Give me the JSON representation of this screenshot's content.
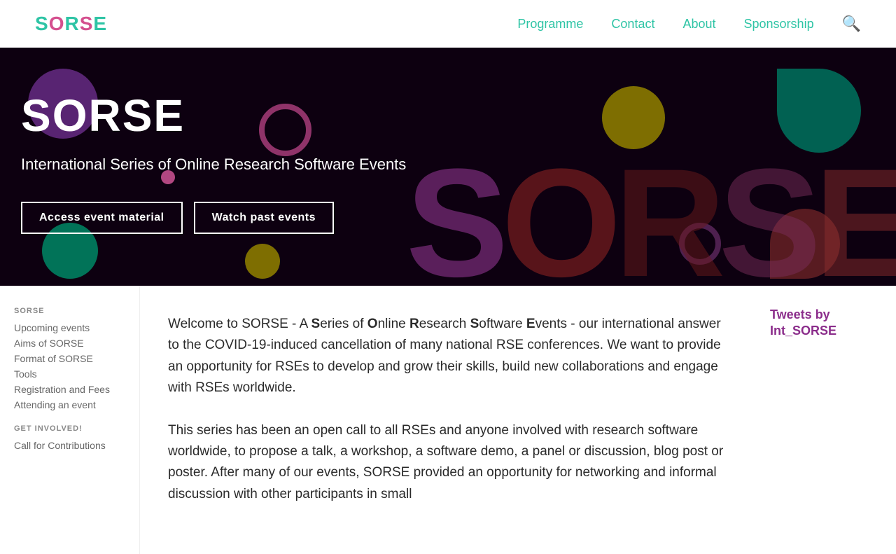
{
  "nav": {
    "logo": {
      "s1": "S",
      "o": "O",
      "r": "R",
      "s2": "S",
      "e": "E"
    },
    "links": [
      {
        "id": "programme",
        "label": "Programme"
      },
      {
        "id": "contact",
        "label": "Contact"
      },
      {
        "id": "about",
        "label": "About"
      },
      {
        "id": "sponsorship",
        "label": "Sponsorship"
      }
    ]
  },
  "hero": {
    "title": "SORSE",
    "subtitle": "International Series of Online Research Software Events",
    "button1": "Access event material",
    "button2": "Watch past events"
  },
  "sidebar": {
    "section1_title": "SORSE",
    "section1_links": [
      "Upcoming events",
      "Aims of SORSE",
      "Format of SORSE",
      "Tools",
      "Registration and Fees",
      "Attending an event"
    ],
    "section2_title": "GET INVOLVED!",
    "section2_links": [
      "Call for Contributions"
    ]
  },
  "content": {
    "para1_prefix": "Welcome to SORSE - A ",
    "para1_bold1": "S",
    "para1_t1": "eries of ",
    "para1_bold2": "O",
    "para1_t2": "nline ",
    "para1_bold3": "R",
    "para1_t3": "esearch ",
    "para1_bold4": "S",
    "para1_t4": "oftware ",
    "para1_bold5": "E",
    "para1_t5": "vents - our international answer to the COVID-19-induced cancellation of many national RSE conferences. We want to provide an opportunity for RSEs to develop and grow their skills, build new collaborations and engage with RSEs worldwide.",
    "para2": "This series has been an open call to all RSEs and anyone involved with research software worldwide, to propose a talk, a workshop, a software demo, a panel or discussion, blog post or poster. After many of our events, SORSE provided an opportunity for networking and informal discussion with other participants in small"
  },
  "tweets": {
    "label": "Tweets by Int_SORSE"
  }
}
